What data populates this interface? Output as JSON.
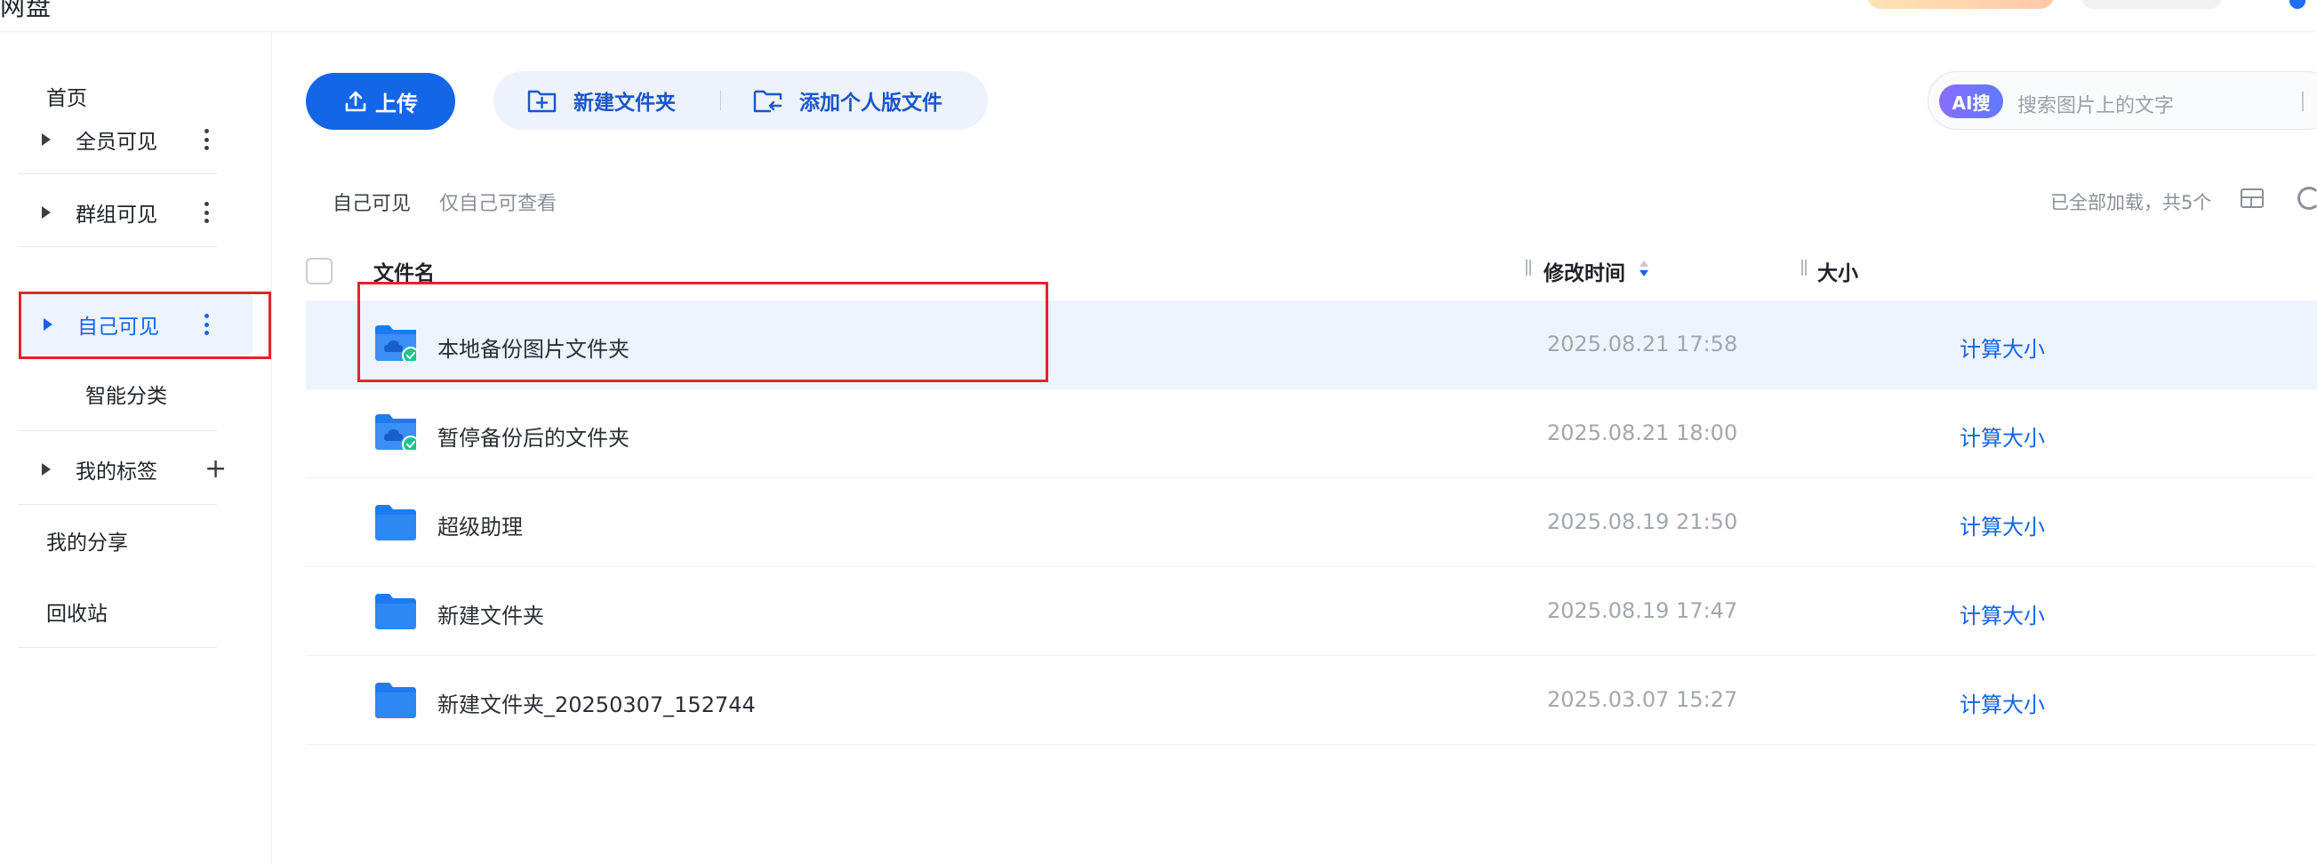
{
  "topbar": {
    "title_fragment": "网盘"
  },
  "sidebar": {
    "items": [
      {
        "label": "首页",
        "expandable": false,
        "menu": false
      },
      {
        "label": "全员可见",
        "expandable": true,
        "menu": true
      },
      {
        "label": "群组可见",
        "expandable": true,
        "menu": true
      },
      {
        "label": "自己可见",
        "expandable": true,
        "menu": true,
        "active": true
      },
      {
        "label": "智能分类",
        "expandable": false,
        "menu": false,
        "indented": true
      },
      {
        "label": "我的标签",
        "expandable": true,
        "add": true
      },
      {
        "label": "我的分享"
      },
      {
        "label": "回收站"
      }
    ]
  },
  "toolbar": {
    "upload_label": "上传",
    "new_folder_label": "新建文件夹",
    "add_personal_label": "添加个人版文件"
  },
  "search": {
    "ai_badge": "AI搜",
    "placeholder": "搜索图片上的文字"
  },
  "breadcrumb": {
    "current": "自己可见",
    "description": "仅自己可查看",
    "status": "已全部加载，共5个"
  },
  "table": {
    "headers": {
      "name": "文件名",
      "modified": "修改时间",
      "size": "大小"
    },
    "rows": [
      {
        "name": "本地备份图片文件夹",
        "modified": "2025.08.21 17:58",
        "size_action": "计算大小",
        "backup_badge": true,
        "selected": true
      },
      {
        "name": "暂停备份后的文件夹",
        "modified": "2025.08.21 18:00",
        "size_action": "计算大小",
        "backup_badge": true
      },
      {
        "name": "超级助理",
        "modified": "2025.08.19 21:50",
        "size_action": "计算大小"
      },
      {
        "name": "新建文件夹",
        "modified": "2025.08.19 17:47",
        "size_action": "计算大小"
      },
      {
        "name": "新建文件夹_20250307_152744",
        "modified": "2025.03.07 15:27",
        "size_action": "计算大小"
      }
    ]
  },
  "colors": {
    "primary": "#1466e8",
    "link": "#1364e8",
    "highlight": "#e0262b",
    "selected_row": "#eef4fe"
  }
}
